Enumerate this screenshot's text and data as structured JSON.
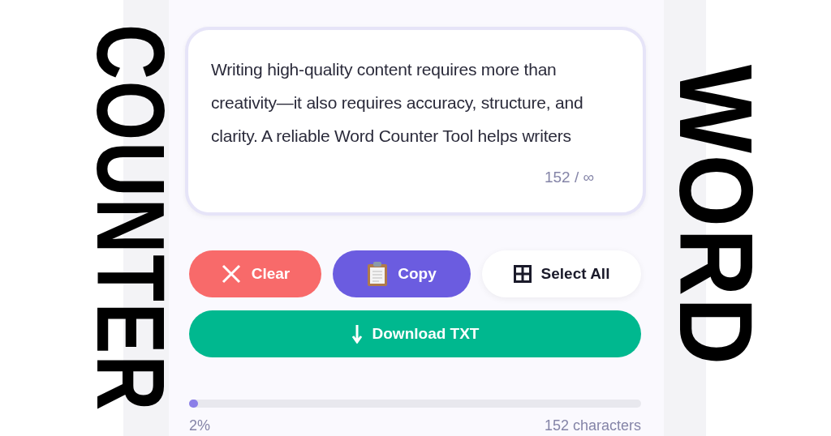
{
  "side_titles": [
    {
      "text": "COUNTER",
      "kind": "left"
    },
    {
      "text": "WORD",
      "kind": "right"
    }
  ],
  "editor": {
    "value": "Writing high-quality content requires more than creativity—it also requires accuracy, structure, and clarity. A reliable Word Counter Tool helps writers",
    "counter": "152 / ∞"
  },
  "buttons": [
    {
      "kind": "clear",
      "label": "Clear"
    },
    {
      "kind": "copy",
      "label": "Copy"
    },
    {
      "kind": "select",
      "label": "Select All"
    },
    {
      "kind": "download",
      "label": "Download TXT"
    }
  ],
  "progress": {
    "level": 0.02,
    "percent": "2%",
    "characters": "152 characters"
  }
}
